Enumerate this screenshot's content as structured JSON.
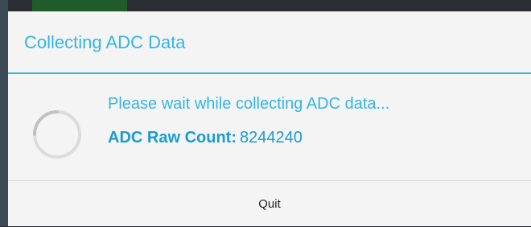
{
  "dialog": {
    "title": "Collecting ADC Data",
    "message": "Please wait while collecting ADC data...",
    "count_label": "ADC Raw Count:",
    "count_value": "8244240",
    "quit_label": "Quit",
    "spinner_icon": "progress-spinner-icon"
  },
  "colors": {
    "accent": "#33b5e5",
    "count_text": "#1a9bd1",
    "dialog_background": "#f4f4f4",
    "backdrop": "#2a2e33"
  }
}
